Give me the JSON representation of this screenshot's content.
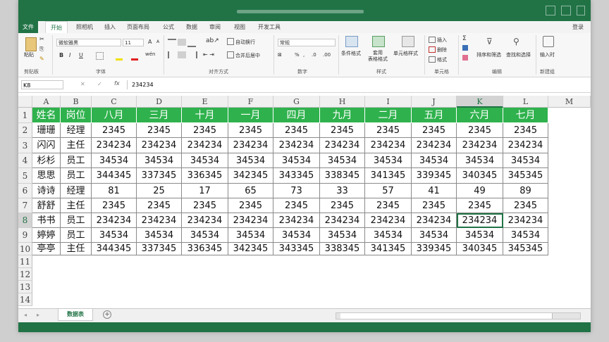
{
  "title_tabs": {
    "file": "文件",
    "tabs": [
      "开始",
      "照相机",
      "插入",
      "页面布局",
      "公式",
      "数据",
      "审阅",
      "视图",
      "开发工具"
    ],
    "login": "登录"
  },
  "ribbon": {
    "font_name": "微软雅黑",
    "font_size": "11",
    "wrap_text": "自动换行",
    "merge_center": "合并后居中",
    "number_format": "常规",
    "cond_format": "条件格式",
    "table_format": "套用\n表格格式",
    "cell_style": "单元格样式",
    "insert": "插入",
    "delete": "删除",
    "format": "格式",
    "sort_filter": "排序和筛选",
    "find_select": "查找和选择",
    "input_time": "输入时",
    "paste": "粘贴",
    "group_clipboard": "剪贴板",
    "group_font": "字体",
    "group_align": "对齐方式",
    "group_number": "数字",
    "group_style": "样式",
    "group_cells": "单元格",
    "group_edit": "编辑",
    "group_new": "新建组",
    "bold": "B",
    "italic": "I",
    "underline": "U",
    "grow_font": "A",
    "fx": "fx"
  },
  "formula_bar": {
    "name_box": "K8",
    "value": "234234"
  },
  "columns": [
    "A",
    "B",
    "C",
    "D",
    "E",
    "F",
    "G",
    "H",
    "I",
    "J",
    "K",
    "L",
    "M"
  ],
  "rows": [
    "1",
    "2",
    "3",
    "4",
    "5",
    "6",
    "7",
    "8",
    "9",
    "10",
    "11",
    "12",
    "13",
    "14"
  ],
  "table": {
    "headers": [
      "姓名",
      "岗位",
      "八月",
      "三月",
      "十月",
      "一月",
      "四月",
      "九月",
      "二月",
      "五月",
      "六月",
      "七月"
    ],
    "rows": [
      [
        "珊珊",
        "经理",
        "2345",
        "2345",
        "2345",
        "2345",
        "2345",
        "2345",
        "2345",
        "2345",
        "2345",
        "2345"
      ],
      [
        "闪闪",
        "主任",
        "234234",
        "234234",
        "234234",
        "234234",
        "234234",
        "234234",
        "234234",
        "234234",
        "234234",
        "234234"
      ],
      [
        "杉杉",
        "员工",
        "34534",
        "34534",
        "34534",
        "34534",
        "34534",
        "34534",
        "34534",
        "34534",
        "34534",
        "34534"
      ],
      [
        "思思",
        "员工",
        "344345",
        "337345",
        "336345",
        "342345",
        "343345",
        "338345",
        "341345",
        "339345",
        "340345",
        "345345"
      ],
      [
        "诗诗",
        "经理",
        "81",
        "25",
        "17",
        "65",
        "73",
        "33",
        "57",
        "41",
        "49",
        "89"
      ],
      [
        "舒舒",
        "主任",
        "2345",
        "2345",
        "2345",
        "2345",
        "2345",
        "2345",
        "2345",
        "2345",
        "2345",
        "2345"
      ],
      [
        "书书",
        "员工",
        "234234",
        "234234",
        "234234",
        "234234",
        "234234",
        "234234",
        "234234",
        "234234",
        "234234",
        "234234"
      ],
      [
        "婷婷",
        "员工",
        "34534",
        "34534",
        "34534",
        "34534",
        "34534",
        "34534",
        "34534",
        "34534",
        "34534",
        "34534"
      ],
      [
        "亭亭",
        "主任",
        "344345",
        "337345",
        "336345",
        "342345",
        "343345",
        "338345",
        "341345",
        "339345",
        "340345",
        "345345"
      ]
    ]
  },
  "sheet_tab": "数据表",
  "colors": {
    "accent": "#217346",
    "header_fill": "#2fb24d"
  }
}
